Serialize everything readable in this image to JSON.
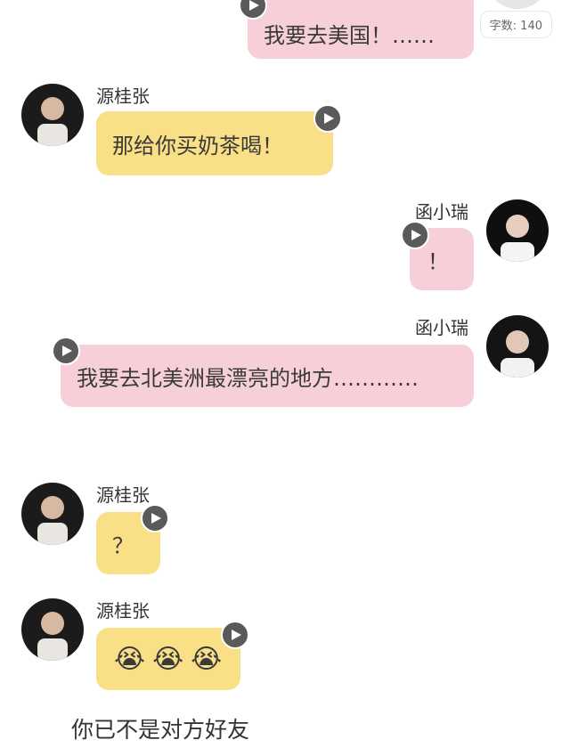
{
  "counter": {
    "label": "字数: 140"
  },
  "messages": [
    {
      "sender": "",
      "text": "我要去美国！……"
    },
    {
      "sender": "源桂张",
      "text": "那给你买奶茶喝！"
    },
    {
      "sender": "函小瑞",
      "text": "！"
    },
    {
      "sender": "函小瑞",
      "text": "我要去北美洲最漂亮的地方…………"
    },
    {
      "sender": "源桂张",
      "text": "？"
    },
    {
      "sender": "源桂张",
      "emojis": [
        "😭",
        "😭",
        "😭"
      ]
    }
  ],
  "footer": {
    "text": "你已不是对方好友"
  },
  "colors": {
    "pink": "#f7cfd8",
    "yellow": "#f9df86",
    "play": "#5a5a5a"
  },
  "icons": {
    "play": "play-icon",
    "avatar_left": "avatar-icon",
    "avatar_right": "avatar-icon"
  }
}
